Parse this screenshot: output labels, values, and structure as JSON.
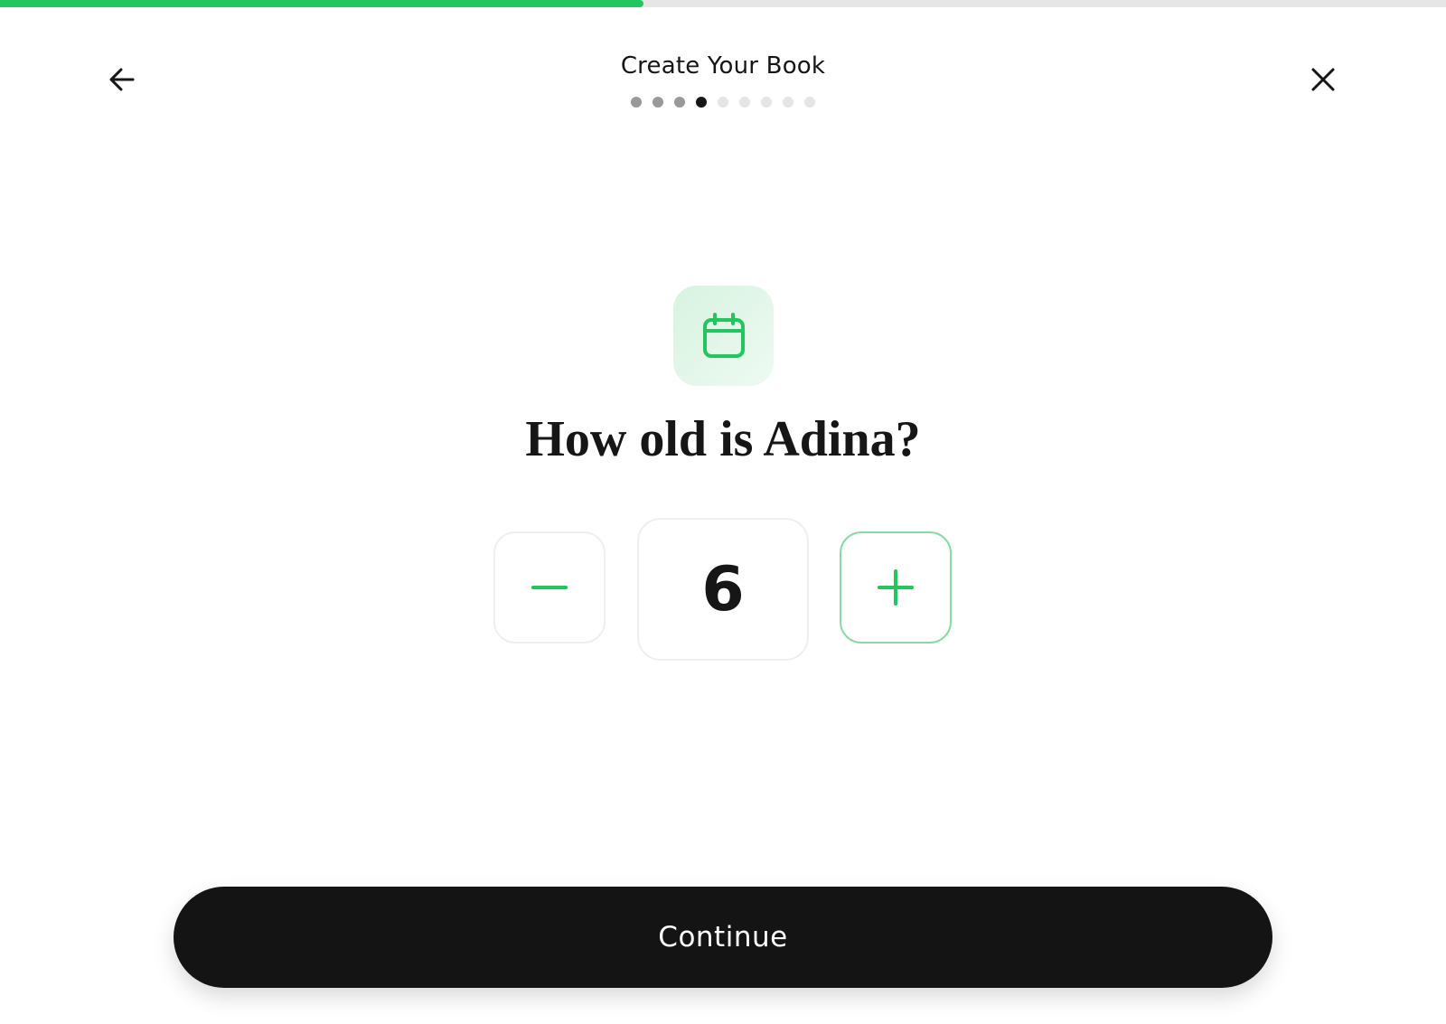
{
  "progress": {
    "fraction": 0.445,
    "color": "#22c55e"
  },
  "header": {
    "title": "Create Your Book",
    "back_icon": "arrow-left-icon",
    "close_icon": "close-icon",
    "steps": {
      "total": 9,
      "current": 4
    }
  },
  "question": {
    "icon": "calendar-icon",
    "text": "How old is Adina?"
  },
  "age_stepper": {
    "value": "6",
    "decrement_icon": "minus-icon",
    "increment_icon": "plus-icon"
  },
  "footer": {
    "continue_label": "Continue"
  },
  "colors": {
    "accent": "#22c55e",
    "button_dark": "#141414"
  }
}
